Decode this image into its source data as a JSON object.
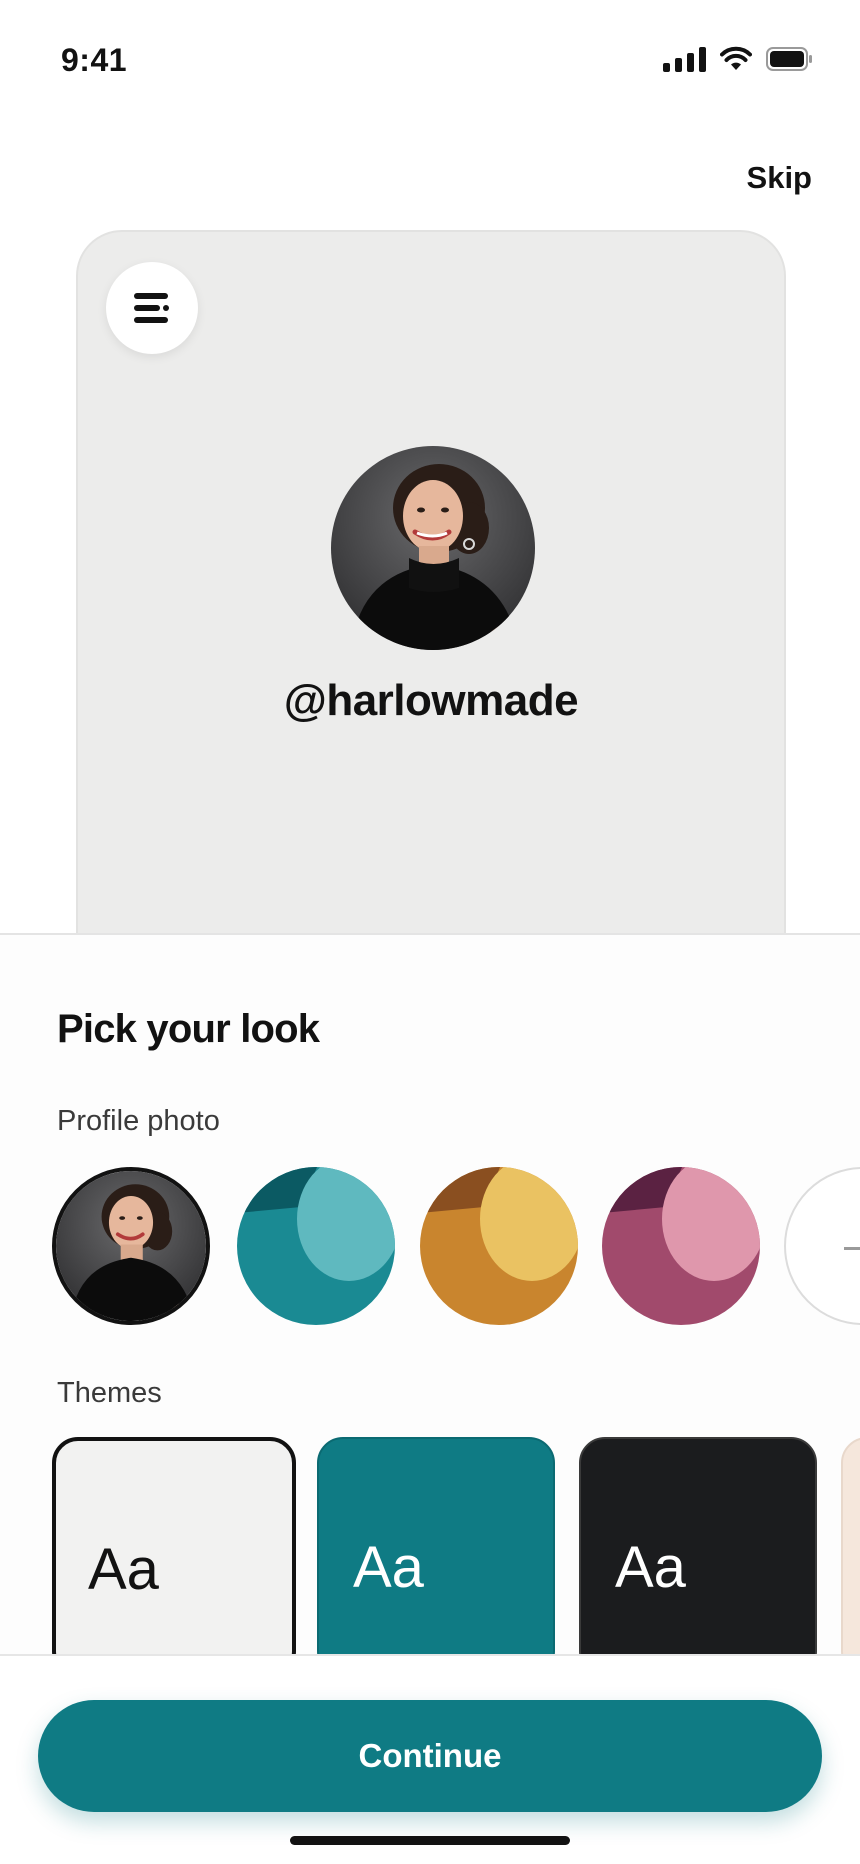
{
  "status_bar": {
    "time": "9:41"
  },
  "header": {
    "skip_label": "Skip"
  },
  "preview": {
    "handle": "@harlowmade",
    "menu_icon": "menu-lines-icon"
  },
  "sheet": {
    "title": "Pick your look",
    "profile_photo_label": "Profile photo",
    "themes_label": "Themes",
    "photo_options": [
      {
        "kind": "photo",
        "selected": true
      },
      {
        "kind": "color-blob",
        "base": "#1a8a93",
        "accent": "#5fb9bf",
        "edge": "#0b5a63"
      },
      {
        "kind": "color-blob",
        "base": "#c9852e",
        "accent": "#eac262",
        "edge": "#8a4f20"
      },
      {
        "kind": "color-blob",
        "base": "#a14a6c",
        "accent": "#df97ac",
        "edge": "#5b2242"
      },
      {
        "kind": "add-more"
      }
    ],
    "themes": [
      {
        "sample": "Aa",
        "bg": "#f2f2f1",
        "text_color": "#121212",
        "selected": true
      },
      {
        "sample": "Aa",
        "bg": "#0f7b84",
        "text_color": "#ffffff",
        "selected": false
      },
      {
        "sample": "Aa",
        "bg": "#1b1c1e",
        "text_color": "#ffffff",
        "selected": false
      },
      {
        "sample": "",
        "bg": "#f5e7dc",
        "text_color": "#121212",
        "selected": false
      }
    ]
  },
  "footer": {
    "continue_label": "Continue"
  },
  "colors": {
    "accent": "#0f7b84",
    "text": "#121212"
  }
}
